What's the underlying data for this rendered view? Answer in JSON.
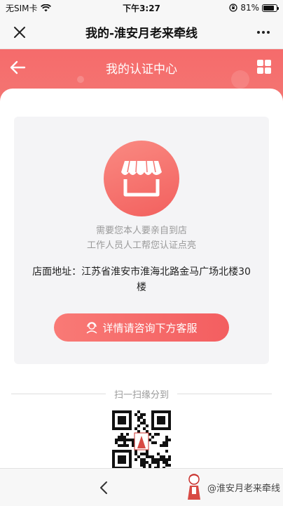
{
  "status_bar": {
    "carrier": "无SIM卡",
    "time": "下午3:27",
    "battery": "81%",
    "battery_level": 0.81
  },
  "wechat_nav": {
    "title": "我的-淮安月老来牵线"
  },
  "header": {
    "title": "我的认证中心"
  },
  "auth": {
    "desc_line1": "需要您本人要亲自到店",
    "desc_line2": "工作人员人工帮您认证点亮",
    "address_label": "店面地址：",
    "address_value": "江苏省淮安市淮海北路金马广场北楼30楼",
    "button_label": "详情请咨询下方客服"
  },
  "share": {
    "label": "扫一扫缘分到"
  },
  "watermark": {
    "text": "@淮安月老来牵线"
  },
  "colors": {
    "accent": "#f56b6b",
    "accent_dark": "#f35e60"
  },
  "icons": [
    "close-icon",
    "more-icon",
    "back-arrow-icon",
    "grid-icon",
    "shop-icon",
    "service-icon",
    "chevron-left-icon"
  ]
}
